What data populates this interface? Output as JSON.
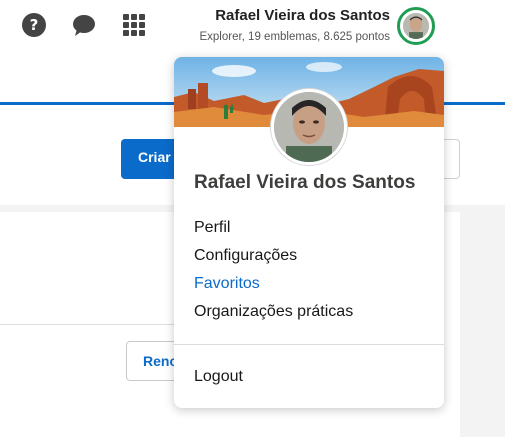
{
  "header": {
    "user_name": "Rafael Vieira dos Santos",
    "user_stats": "Explorer, 19 emblemas, 8.625 pontos",
    "icons": [
      "help-icon",
      "chat-icon",
      "app-launcher-icon"
    ],
    "ring_color": "#1f9d55"
  },
  "page": {
    "create_button_label": "Criar",
    "secondary_button_label": "Renc",
    "accent_color": "#0b6bcb"
  },
  "dropdown": {
    "name": "Rafael Vieira dos Santos",
    "items": [
      {
        "label": "Perfil"
      },
      {
        "label": "Configurações"
      },
      {
        "label": "Favoritos",
        "highlighted": true
      },
      {
        "label": "Organizações práticas"
      }
    ],
    "logout_label": "Logout"
  }
}
